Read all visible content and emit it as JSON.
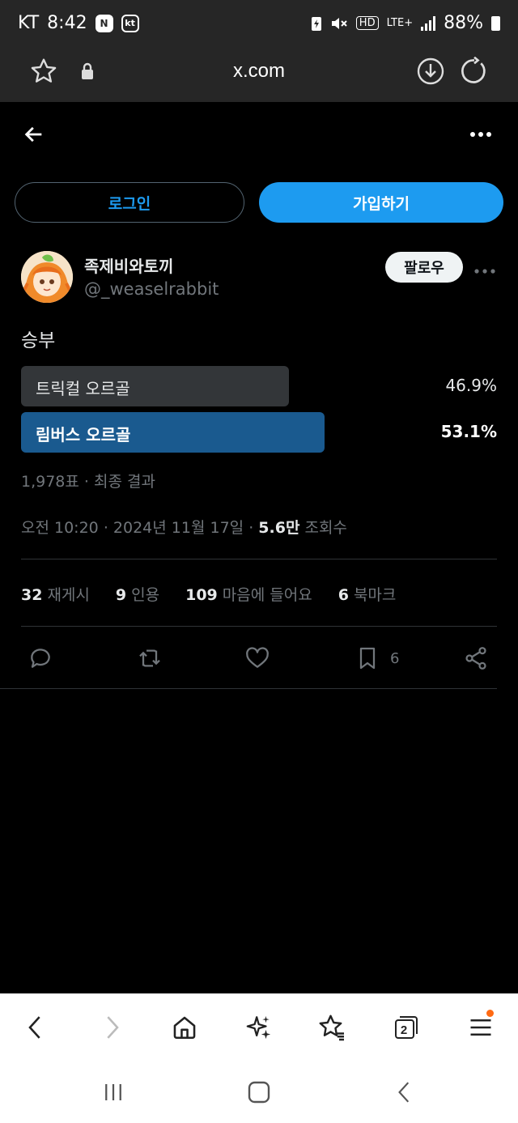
{
  "status_bar": {
    "carrier": "KT",
    "time": "8:42",
    "badge_n": "N",
    "badge_kt": "kt",
    "hd_label": "HD",
    "network": "LTE+",
    "battery": "88%"
  },
  "browser": {
    "url": "x.com",
    "tab_count": "2"
  },
  "auth": {
    "login_label": "로그인",
    "signup_label": "가입하기"
  },
  "post": {
    "display_name": "족제비와토끼",
    "handle": "@_weaselrabbit",
    "follow_label": "팔로우",
    "text": "승부",
    "poll": {
      "options": [
        {
          "label": "트릭컬 오르골",
          "percent": "46.9%",
          "fraction": 0.469
        },
        {
          "label": "림버스 오르골",
          "percent": "53.1%",
          "fraction": 0.531
        }
      ],
      "meta": "1,978표 · 최종 결과"
    },
    "timestamp": {
      "time": "오전 10:20",
      "date": "2024년 11월 17일",
      "views_value": "5.6만",
      "views_label": "조회수"
    },
    "stats": {
      "reposts_count": "32",
      "reposts_label": "재게시",
      "quotes_count": "9",
      "quotes_label": "인용",
      "likes_count": "109",
      "likes_label": "마음에 들어요",
      "bookmarks_count": "6",
      "bookmarks_label": "북마크"
    },
    "actions": {
      "bookmark_count": "6"
    }
  },
  "colors": {
    "accent": "#1d9bf0",
    "winner_bar": "#1a5a8f",
    "loser_bar": "#333639"
  }
}
